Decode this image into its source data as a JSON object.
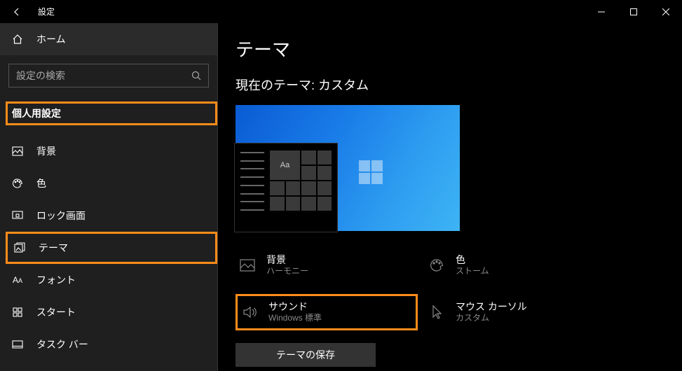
{
  "window": {
    "title": "設定"
  },
  "sidebar": {
    "home": "ホーム",
    "search_placeholder": "設定の検索",
    "category": "個人用設定",
    "items": [
      {
        "label": "背景"
      },
      {
        "label": "色"
      },
      {
        "label": "ロック画面"
      },
      {
        "label": "テーマ"
      },
      {
        "label": "フォント"
      },
      {
        "label": "スタート"
      },
      {
        "label": "タスク バー"
      }
    ]
  },
  "main": {
    "title": "テーマ",
    "subhead": "現在のテーマ: カスタム",
    "preview_tile_text": "Aa",
    "settings": {
      "background": {
        "title": "背景",
        "value": "ハーモニー"
      },
      "color": {
        "title": "色",
        "value": "ストーム"
      },
      "sound": {
        "title": "サウンド",
        "value": "Windows 標準"
      },
      "cursor": {
        "title": "マウス カーソル",
        "value": "カスタム"
      }
    },
    "save_button": "テーマの保存"
  }
}
